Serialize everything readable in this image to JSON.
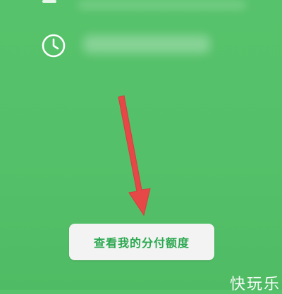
{
  "screen": {
    "background_color": "#55c06a",
    "accent_color": "#2aa84f",
    "arrow_color": "#e64848"
  },
  "row": {
    "icon": "clock-icon"
  },
  "button": {
    "label": "查看我的分付额度"
  },
  "watermark": {
    "text": "快玩乐"
  }
}
